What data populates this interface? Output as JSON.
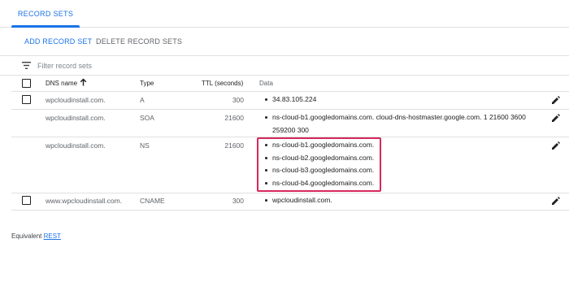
{
  "tabs": {
    "active_label": "RECORD SETS"
  },
  "toolbar": {
    "add_label": "ADD RECORD SET",
    "delete_label": "DELETE RECORD SETS"
  },
  "filter": {
    "placeholder": "Filter record sets",
    "icon": "filter-icon"
  },
  "table": {
    "columns": {
      "name": "DNS name",
      "type": "Type",
      "ttl": "TTL (seconds)",
      "data": "Data"
    },
    "sort": {
      "column": "DNS name",
      "direction": "ascending",
      "icon": "arrow-up-icon"
    },
    "rows": [
      {
        "name": "wpcloudinstall.com.",
        "type": "A",
        "ttl": "300",
        "data": [
          "34.83.105.224"
        ]
      },
      {
        "name": "wpcloudinstall.com.",
        "type": "SOA",
        "ttl": "21600",
        "data": [
          "ns-cloud-b1.googledomains.com. cloud-dns-hostmaster.google.com. 1 21600 3600 259200 300"
        ]
      },
      {
        "name": "wpcloudinstall.com.",
        "type": "NS",
        "ttl": "21600",
        "data": [
          "ns-cloud-b1.googledomains.com.",
          "ns-cloud-b2.googledomains.com.",
          "ns-cloud-b3.googledomains.com.",
          "ns-cloud-b4.googledomains.com."
        ]
      },
      {
        "name": "www.wpcloudinstall.com.",
        "type": "CNAME",
        "ttl": "300",
        "data": [
          "wpcloudinstall.com."
        ]
      }
    ]
  },
  "footer": {
    "prefix": "Equivalent ",
    "link": "REST"
  },
  "colors": {
    "accent": "#1a73e8",
    "highlight": "#d6285b",
    "divider": "#e0e0e0"
  }
}
